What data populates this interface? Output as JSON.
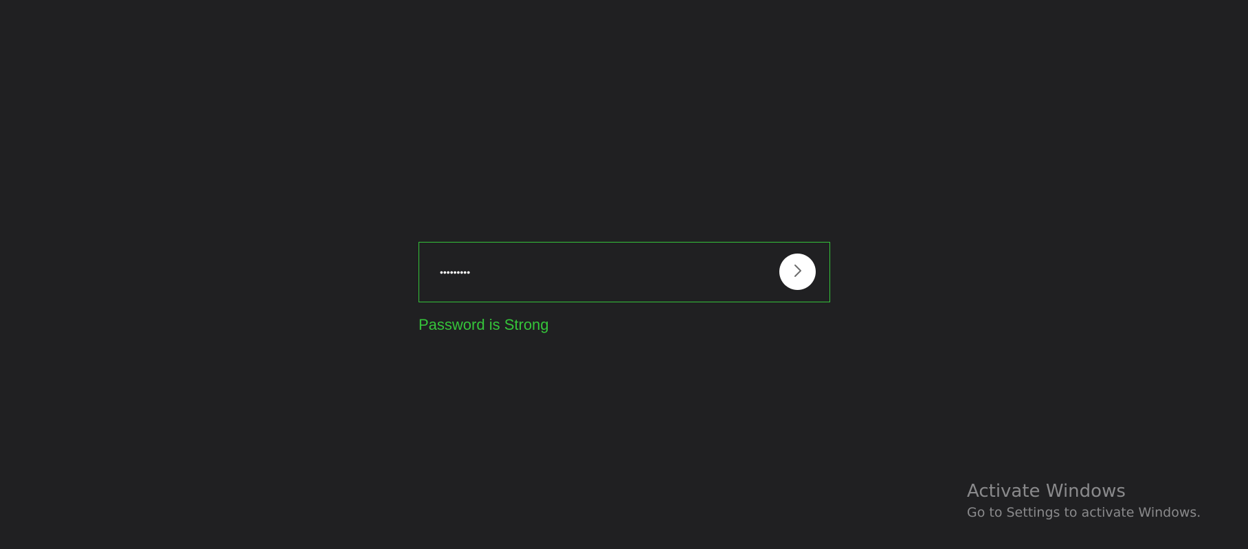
{
  "password_form": {
    "masked_value": "•••••••••",
    "status_message": "Password is Strong",
    "submit_icon": "chevron-right-icon"
  },
  "watermark": {
    "title": "Activate Windows",
    "subtitle": "Go to Settings to activate Windows."
  },
  "colors": {
    "background": "#202022",
    "accent_green": "#35c43a",
    "text_white": "#ffffff",
    "watermark_gray": "#8a8a8c"
  }
}
